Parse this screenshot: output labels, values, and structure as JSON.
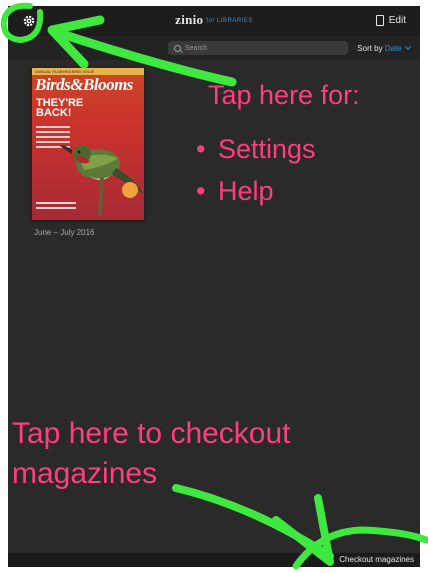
{
  "topbar": {
    "settings_icon": "gear-icon",
    "logo": "zinio",
    "logo_sub": "for LIBRARIES",
    "edit_icon": "document-icon",
    "edit_label": "Edit"
  },
  "search": {
    "placeholder": "Search",
    "icon": "search-icon"
  },
  "sort": {
    "label": "Sort by",
    "value": "Date",
    "icon": "chevron-down-icon"
  },
  "magazine": {
    "masthead": "Birds&Blooms",
    "band": "ANNUAL HUMMINGBIRD ISSUE",
    "headline": "THEY'RE\nBACK!",
    "issue_date": "June – July 2016"
  },
  "annotations": {
    "settings_title": "Tap here for:",
    "items": [
      "Settings",
      "Help"
    ],
    "checkout_note": "Tap here to checkout magazines"
  },
  "bottombar": {
    "checkout_label": "Checkout magazines"
  },
  "colors": {
    "screen_bg": "#2a2a2a",
    "accent": "#3d8fc7",
    "annotation": "#ff3d7f",
    "arrow": "#3ee83e"
  }
}
